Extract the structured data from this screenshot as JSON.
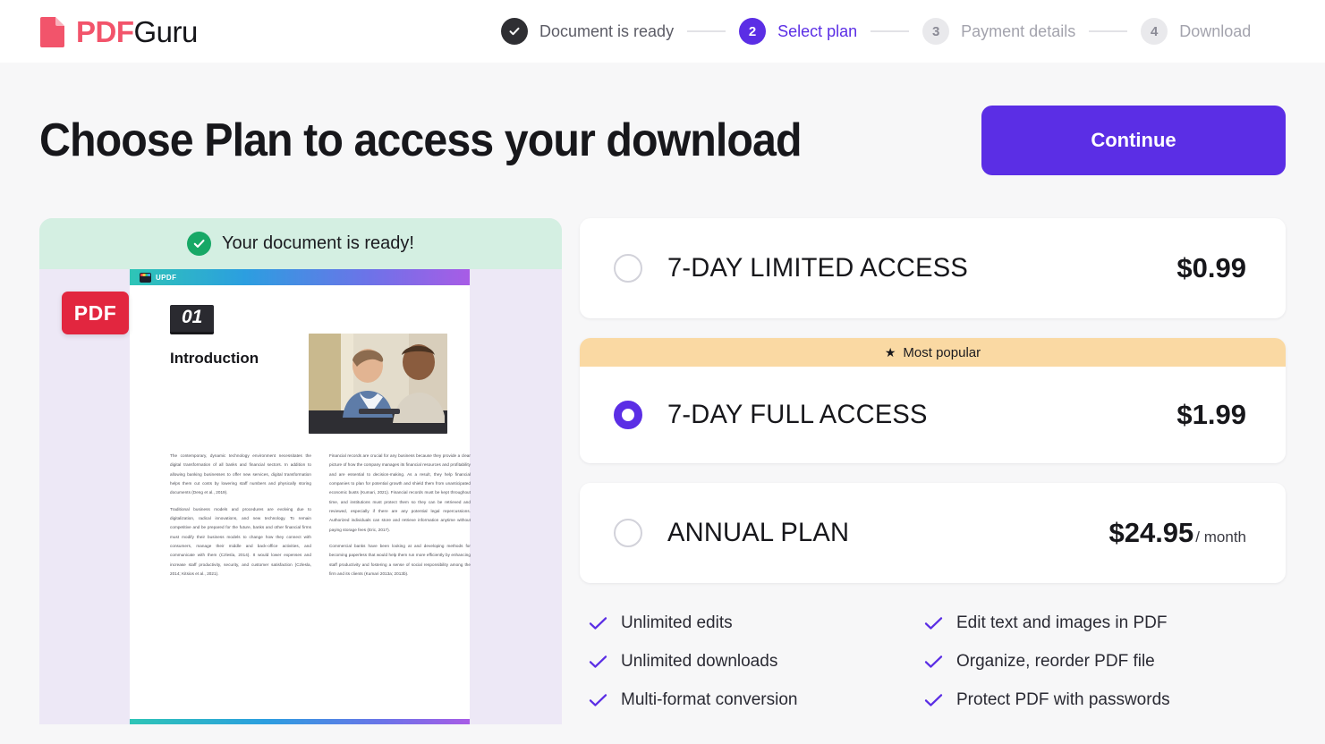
{
  "brand": {
    "pdf": "PDF",
    "guru": "Guru",
    "logo_icon": "pdf-document-icon",
    "pdf_color": "#F2546B"
  },
  "stepper": {
    "steps": [
      {
        "num": "1",
        "label": "Document is ready",
        "state": "done",
        "icon": "check-icon"
      },
      {
        "num": "2",
        "label": "Select plan",
        "state": "active"
      },
      {
        "num": "3",
        "label": "Payment details",
        "state": "todo"
      },
      {
        "num": "4",
        "label": "Download",
        "state": "todo"
      }
    ]
  },
  "header": {
    "title": "Choose Plan to access your download",
    "continue_label": "Continue",
    "accent_color": "#5B2EE5"
  },
  "preview": {
    "ready_text": "Your document is ready!",
    "ready_icon": "circle-check-icon",
    "ready_bg": "#D4EFE2",
    "badge": "PDF",
    "updf_label": "UPDF",
    "section_number": "01",
    "section_title": "Introduction",
    "paragraphs_left": [
      "The contemporary, dynamic technology environment necessitates the digital transformation of all banks and financial sectors. In addition to allowing banking businesses to offer new services, digital transformation helps them cut costs by lowering staff numbers and physically storing documents (Deng et al., 2019).",
      "Traditional business models and procedures are evolving due to digitalization, radical innovations, and new technology. To remain competitive and be prepared for the future, banks and other financial firms must modify their business models to change how they connect with consumers, manage their middle and back-office activities, and communicate with them (Czlesla, 2014). It would lower expenses and increase staff productivity, security, and customer satisfaction (Czlesla, 2014; Kitsios et al., 2021)."
    ],
    "paragraphs_right": [
      "Financial records are crucial for any business because they provide a clear picture of how the company manages its financial resources and profitability and are essential to decision-making. As a result, they help financial companies to plan for potential growth and shield them from unanticipated economic busts (Kumari, 2021). Financial records must be kept throughout time, and institutions must protect them so they can be retrieved and reviewed, especially if there are any potential legal repercussions. Authorized individuals can store and retrieve information anytime without paying storage fees (Eric, 2017).",
      "Commercial banks have been looking at and developing methods for becoming paperless that would help them run more efficiently by enhancing staff productivity and fostering a sense of social responsibility among the firm and its clients (Kumari 2013a; 2013b)."
    ]
  },
  "plans": {
    "popular_badge": "Most popular",
    "popular_icon": "star-icon",
    "items": [
      {
        "id": "limited",
        "name": "7-DAY LIMITED ACCESS",
        "price": "$0.99",
        "period": "",
        "selected": false,
        "popular": false
      },
      {
        "id": "full",
        "name": "7-DAY FULL ACCESS",
        "price": "$1.99",
        "period": "",
        "selected": true,
        "popular": true
      },
      {
        "id": "annual",
        "name": "ANNUAL PLAN",
        "price": "$24.95",
        "period": "/ month",
        "selected": false,
        "popular": false
      }
    ]
  },
  "features": {
    "left": [
      "Unlimited edits",
      "Unlimited downloads",
      "Multi-format conversion"
    ],
    "right": [
      "Edit text and images in PDF",
      "Organize, reorder PDF file",
      "Protect PDF with passwords"
    ],
    "check_color": "#5B2EE5"
  }
}
